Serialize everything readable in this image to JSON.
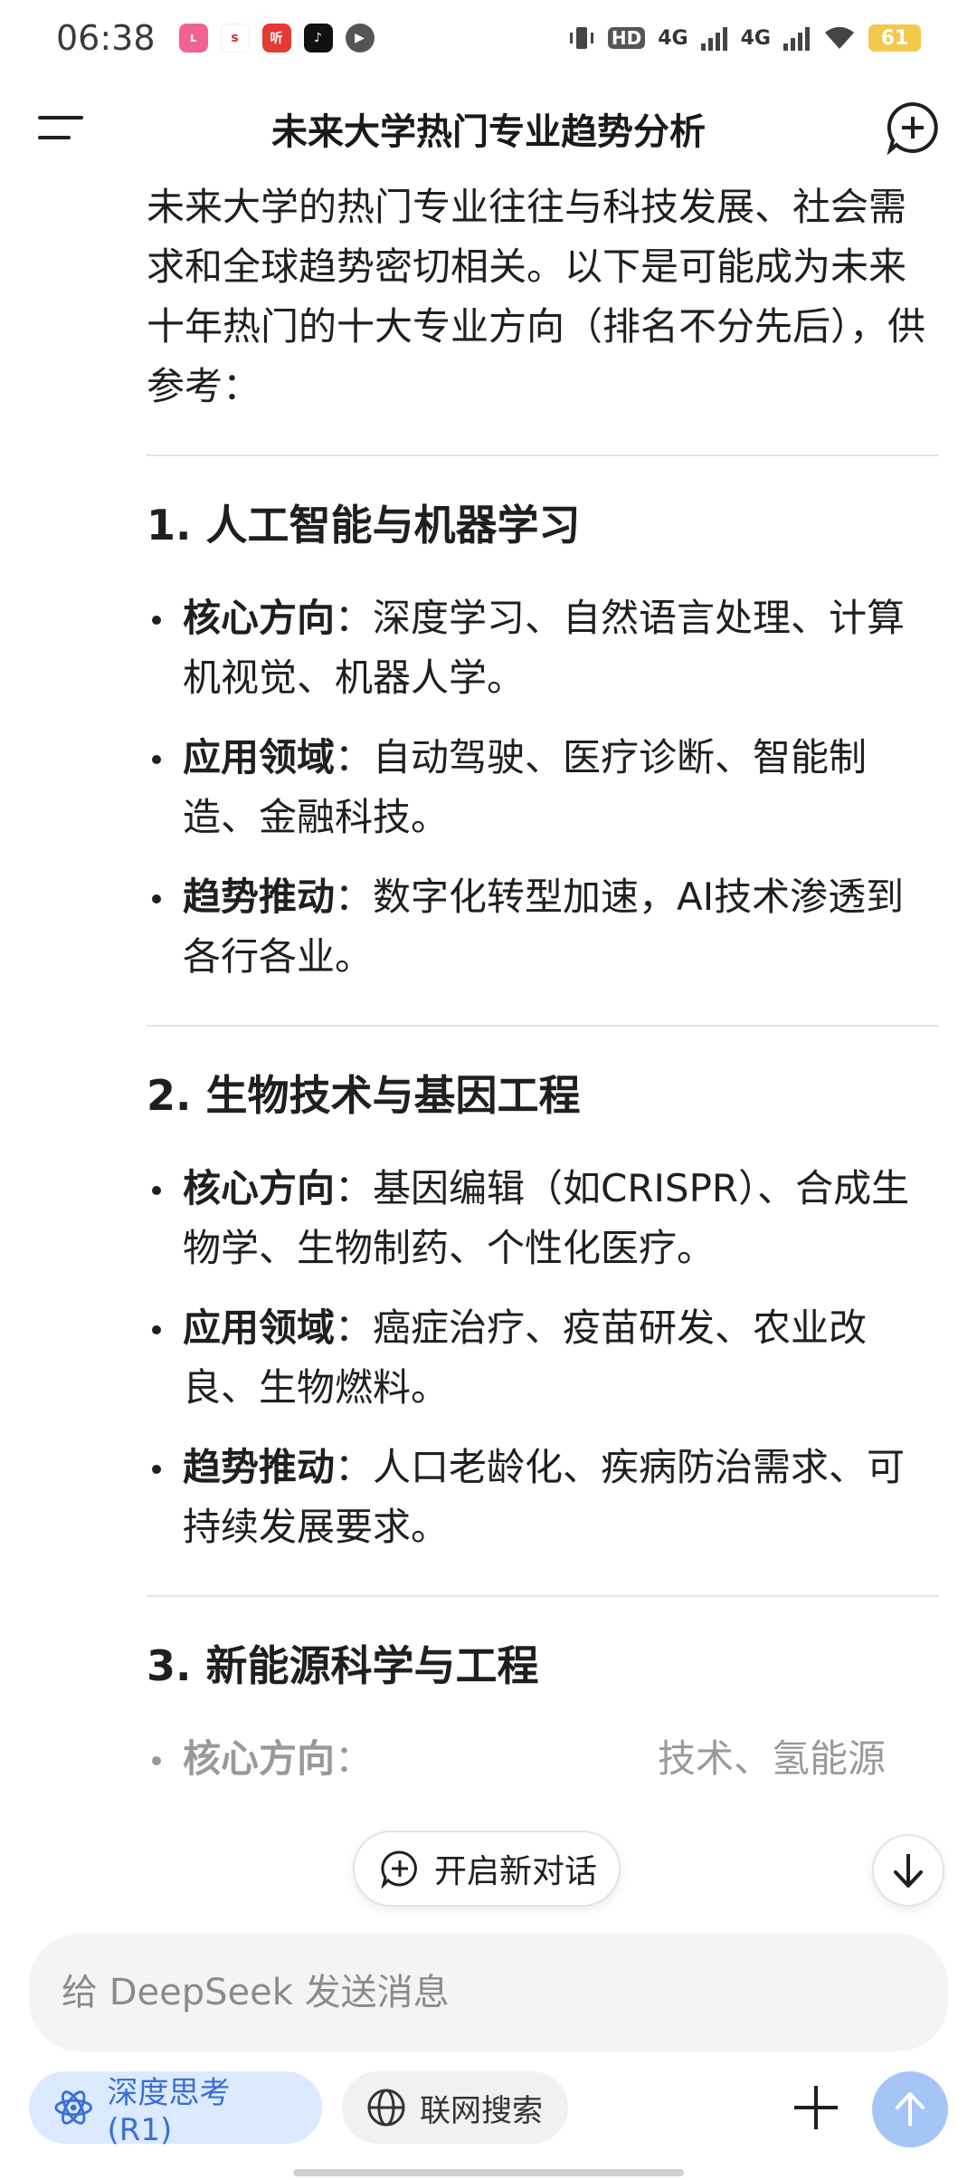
{
  "status_bar": {
    "time": "06:38",
    "apps": [
      "lala",
      "sina",
      "听",
      "tiktok",
      "play"
    ],
    "hd_label": "HD",
    "network1": "4G",
    "network2": "4G",
    "battery": "61"
  },
  "header": {
    "title": "未来大学热门专业趋势分析"
  },
  "intro": "未来大学的热门专业往往与科技发展、社会需求和全球趋势密切相关。以下是可能成为未来十年热门的十大专业方向（排名不分先后），供参考：",
  "sections": [
    {
      "title": "1. 人工智能与机器学习",
      "items": [
        {
          "label": "核心方向",
          "text": "：深度学习、自然语言处理、计算机视觉、机器人学。"
        },
        {
          "label": "应用领域",
          "text": "：自动驾驶、医疗诊断、智能制造、金融科技。"
        },
        {
          "label": "趋势推动",
          "text": "：数字化转型加速，AI技术渗透到各行各业。"
        }
      ]
    },
    {
      "title": "2. 生物技术与基因工程",
      "items": [
        {
          "label": "核心方向",
          "text": "：基因编辑（如CRISPR）、合成生物学、生物制药、个性化医疗。"
        },
        {
          "label": "应用领域",
          "text": "：癌症治疗、疫苗研发、农业改良、生物燃料。"
        },
        {
          "label": "趋势推动",
          "text": "：人口老龄化、疾病防治需求、可持续发展要求。"
        }
      ]
    },
    {
      "title": "3. 新能源科学与工程",
      "items": [
        {
          "label": "核心方向",
          "text": "：　　　　　　　　技术、氢能源"
        }
      ]
    }
  ],
  "overlay": {
    "new_conversation": "开启新对话"
  },
  "input": {
    "placeholder": "给 DeepSeek 发送消息"
  },
  "toolbar": {
    "deep_think": "深度思考 (R1)",
    "web_search": "联网搜索"
  },
  "colors": {
    "accent": "#3b6fd8",
    "accent_bg": "#dbeafe",
    "send_disabled": "#a5c5f7"
  }
}
